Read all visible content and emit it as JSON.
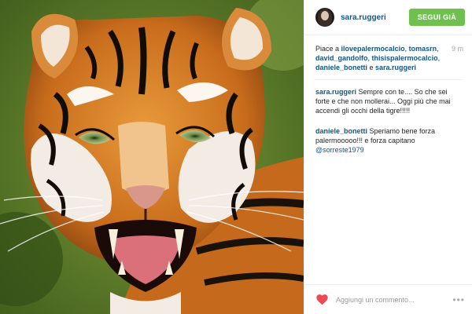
{
  "post": {
    "username": "sara.ruggeri",
    "follow_label": "SEGUI GIÀ",
    "timestamp": "9 m",
    "likes": {
      "prefix": "Piace a ",
      "users": [
        "ilovepalermocalcio",
        "tomasrn",
        "david_gandolfo",
        "thisispalermocalcio",
        "daniele_bonetti"
      ],
      "last_user": "sara.ruggeri",
      "separator": ", ",
      "conjunction": " e "
    },
    "comments": [
      {
        "user": "sara.ruggeri",
        "text": " Sempre con te.... So che sei forte e che non mollerai... Oggi più che mai accendi gli occhi della tigre!!!!!"
      },
      {
        "user": "daniele_bonetti",
        "text": " Speriamo bene forza palermooooo!!! e forza capitano ",
        "mention": "@sorreste1979"
      }
    ],
    "comment_placeholder": "Aggiungi un commento...",
    "more_label": "•••"
  },
  "colors": {
    "link_blue": "#125688",
    "follow_green": "#70c050",
    "heart_red": "#ed4956",
    "muted_gray": "#a5a7aa"
  },
  "icons": {
    "heart": "heart-icon",
    "more": "more-options-icon",
    "avatar": "avatar"
  }
}
